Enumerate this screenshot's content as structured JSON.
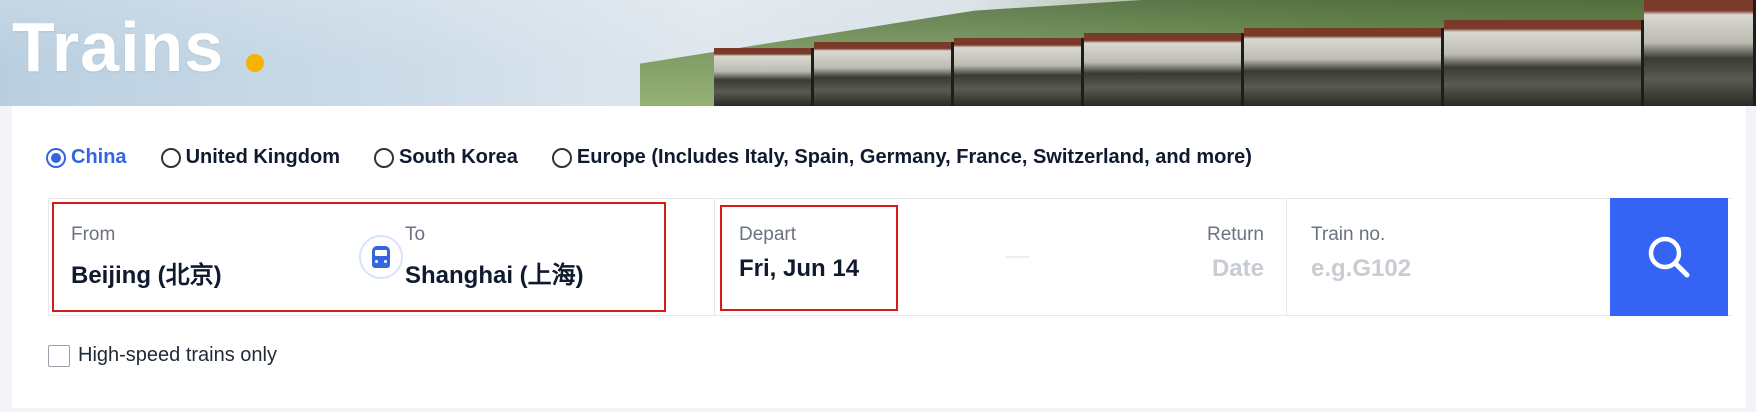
{
  "hero": {
    "title": "Trains",
    "accent_color": "#f4b400"
  },
  "regions": [
    {
      "label": "China",
      "selected": true
    },
    {
      "label": "United Kingdom",
      "selected": false
    },
    {
      "label": "South Korea",
      "selected": false
    },
    {
      "label": "Europe (Includes Italy, Spain, Germany, France, Switzerland, and more)",
      "selected": false
    }
  ],
  "from": {
    "label": "From",
    "value": "Beijing (北京)"
  },
  "to": {
    "label": "To",
    "value": "Shanghai (上海)"
  },
  "swap_icon": "train-swap-icon",
  "depart": {
    "label": "Depart",
    "value": "Fri, Jun 14"
  },
  "return": {
    "label": "Return",
    "placeholder": "Date"
  },
  "train_no": {
    "label": "Train no.",
    "placeholder": "e.g.G102"
  },
  "search_icon": "search-icon",
  "high_speed_only": {
    "label": "High-speed trains only",
    "checked": false
  },
  "colors": {
    "primary": "#3565e0",
    "search_button": "#3564f5",
    "highlight": "#d41b1b"
  }
}
